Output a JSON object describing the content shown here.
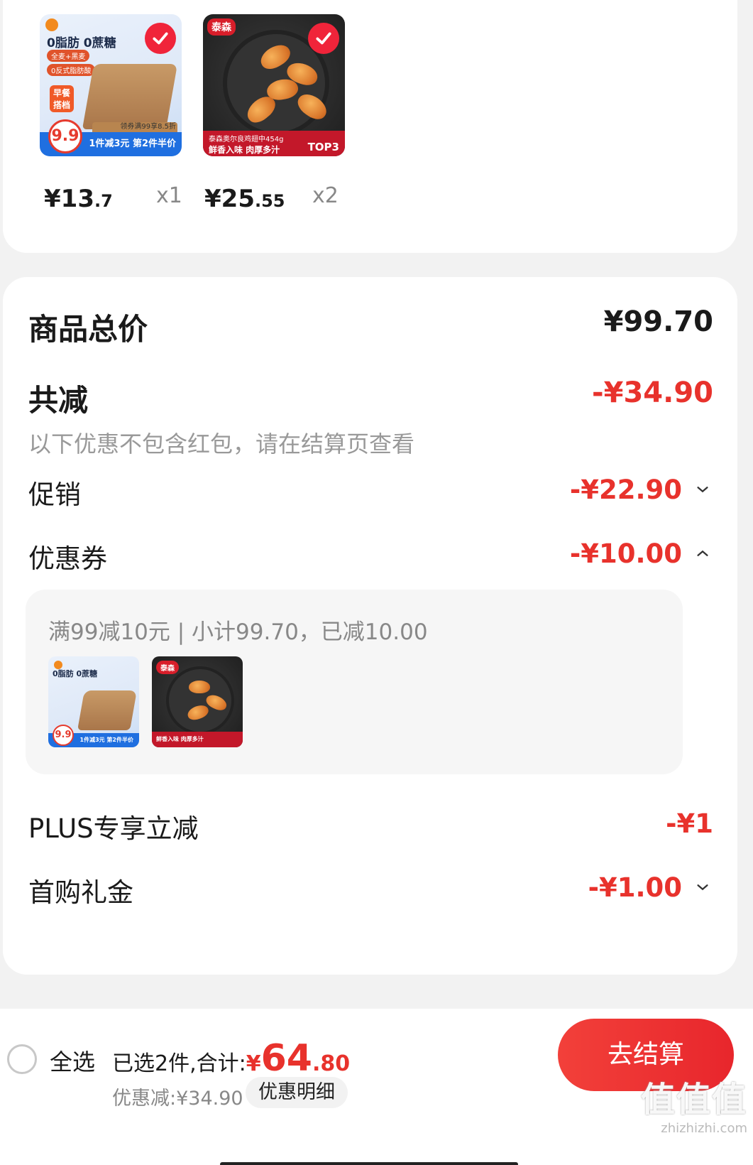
{
  "products": [
    {
      "image_title": "0脂肪 0蔗糖",
      "image_tags": [
        "全麦+黑麦",
        "0反式脂肪酸"
      ],
      "image_side_tag": "早餐搭档",
      "image_price": "9.9",
      "image_promo": "1件减3元 第2件半价",
      "image_coupon": "领券满99享8.5折",
      "price_int": "¥13",
      "price_dec": ".7",
      "qty": "x1",
      "selected": true
    },
    {
      "image_brand": "泰森",
      "image_caption": "泰森奥尔良鸡翅中454g",
      "image_caption2": "鲜香入味  肉厚多汁",
      "image_rank": "TOP3",
      "price_int": "¥25",
      "price_dec": ".55",
      "qty": "x2",
      "selected": true
    }
  ],
  "summary": {
    "total_label": "商品总价",
    "total_value": "¥99.70",
    "reduce_label": "共减",
    "reduce_value": "-¥34.90",
    "note": "以下优惠不包含红包，请在结算页查看",
    "promo_label": "促销",
    "promo_value": "-¥22.90",
    "coupon_label": "优惠券",
    "coupon_value": "-¥10.00",
    "coupon_detail": "满99减10元 | 小计99.70，已减10.00",
    "plus_label": "PLUS专享立减",
    "plus_value": "-¥1",
    "first_label": "首购礼金",
    "first_value": "-¥1.00"
  },
  "footer": {
    "select_all": "全选",
    "selected_text": "已选2件,合计:",
    "currency": "¥",
    "amount_int": "64",
    "amount_dec": ".80",
    "discount_text": "优惠减:¥34.90",
    "detail_button": "优惠明细",
    "checkout_button": "去结算",
    "watermark_logo": "值值值",
    "watermark_url": "zhizhizhi.com"
  },
  "colors": {
    "accent": "#e8322c",
    "background": "#f2f2f2"
  }
}
